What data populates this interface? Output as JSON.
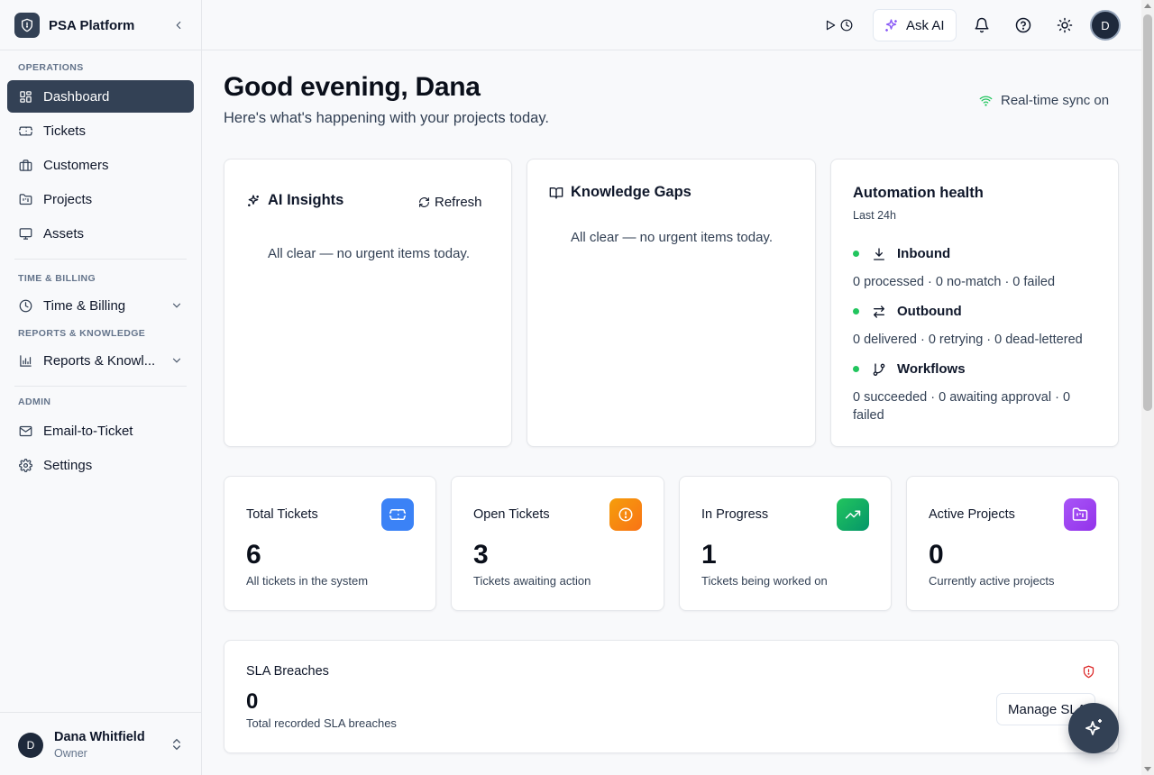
{
  "brand": {
    "name": "PSA Platform"
  },
  "sidebar": {
    "sections": [
      "OPERATIONS",
      "TIME & BILLING",
      "REPORTS & KNOWLEDGE",
      "ADMIN"
    ],
    "items": [
      {
        "label": "Dashboard",
        "icon": "dashboard-icon",
        "active": true
      },
      {
        "label": "Tickets",
        "icon": "ticket-icon"
      },
      {
        "label": "Customers",
        "icon": "briefcase-icon"
      },
      {
        "label": "Projects",
        "icon": "folder-kanban-icon"
      },
      {
        "label": "Assets",
        "icon": "monitor-icon"
      },
      {
        "label": "Time & Billing",
        "icon": "clock-icon"
      },
      {
        "label": "Reports & Knowl...",
        "icon": "bar-chart-icon"
      },
      {
        "label": "Email-to-Ticket",
        "icon": "mail-icon"
      },
      {
        "label": "Settings",
        "icon": "gear-icon"
      }
    ]
  },
  "user": {
    "initial": "D",
    "name": "Dana Whitfield",
    "role": "Owner"
  },
  "topbar": {
    "ask_ai_label": "Ask AI",
    "avatar_initial": "D"
  },
  "header": {
    "greeting": "Good evening, Dana",
    "subtitle": "Here's what's happening with your projects today.",
    "sync_label": "Real-time sync on"
  },
  "ai_insights": {
    "title": "AI Insights",
    "refresh_label": "Refresh",
    "empty": "All clear — no urgent items today."
  },
  "knowledge_gaps": {
    "title": "Knowledge Gaps",
    "empty": "All clear — no urgent items today."
  },
  "automation": {
    "title": "Automation health",
    "subtitle": "Last 24h",
    "rows": [
      {
        "label": "Inbound",
        "detail": "0 processed · 0 no-match · 0 failed",
        "icon": "download-icon"
      },
      {
        "label": "Outbound",
        "detail": "0 delivered · 0 retrying · 0 dead-lettered",
        "icon": "arrows-swap-icon"
      },
      {
        "label": "Workflows",
        "detail": "0 succeeded · 0 awaiting approval · 0 failed",
        "icon": "git-branch-icon"
      }
    ],
    "status_color": "#22c55e"
  },
  "stats": [
    {
      "title": "Total Tickets",
      "value": "6",
      "desc": "All tickets in the system",
      "color": "#3b82f6",
      "icon": "ticket-icon"
    },
    {
      "title": "Open Tickets",
      "value": "3",
      "desc": "Tickets awaiting action",
      "color": "#f59e0b",
      "icon": "alert-circle-icon"
    },
    {
      "title": "In Progress",
      "value": "1",
      "desc": "Tickets being worked on",
      "color": "#16a34a",
      "icon": "trending-up-icon"
    },
    {
      "title": "Active Projects",
      "value": "0",
      "desc": "Currently active projects",
      "color": "#a855f7",
      "icon": "folder-kanban-icon"
    }
  ],
  "sla": {
    "title": "SLA Breaches",
    "value": "0",
    "desc": "Total recorded SLA breaches",
    "button_label": "Manage SLA",
    "icon_color": "#dc2626"
  },
  "colors": {
    "primary": "#334155",
    "background": "#f8f9fb"
  }
}
